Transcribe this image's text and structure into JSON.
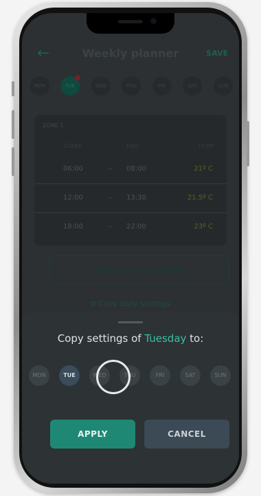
{
  "header": {
    "title": "Weekly planner",
    "save_label": "SAVE"
  },
  "days": [
    "MON",
    "TUE",
    "WED",
    "THU",
    "FRI",
    "SAT",
    "SUN"
  ],
  "zone": {
    "label": "ZONE 1",
    "columns": {
      "start": "START",
      "end": "END",
      "temp": "TEMP"
    },
    "rows": [
      {
        "start": "06:00",
        "dash": "–",
        "end": "08:00",
        "temp": "21º C"
      },
      {
        "start": "12:00",
        "dash": "–",
        "end": "13:30",
        "temp": "21.5º C"
      },
      {
        "start": "18:00",
        "dash": "–",
        "end": "22:00",
        "temp": "23º C"
      }
    ]
  },
  "add_period_label": "Add new time period",
  "copy_daily_label": "Copy daily settings",
  "sheet": {
    "prefix": "Copy settings of ",
    "day": "Tuesday",
    "suffix": " to:",
    "days": [
      "MON",
      "TUE",
      "WED",
      "THU",
      "FRI",
      "SAT",
      "SUN"
    ],
    "apply_label": "APPLY",
    "cancel_label": "CANCEL"
  },
  "colors": {
    "accent": "#38c0a4",
    "apply": "#1f8874",
    "cancel": "#3b4a55"
  }
}
